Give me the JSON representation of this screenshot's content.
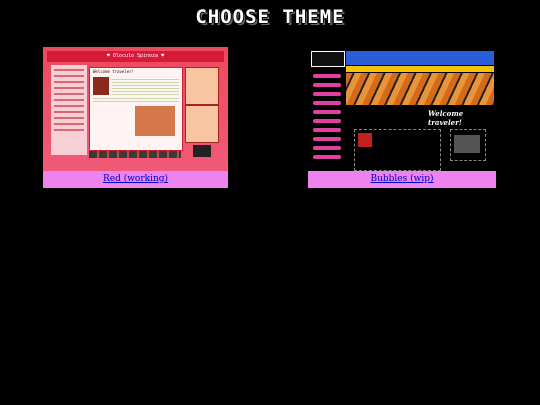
{
  "page": {
    "title": "CHOOSE THEME"
  },
  "themes": [
    {
      "caption": "Red (working)",
      "thumbnail": {
        "header": "♥ Oloculo Spinoza ♥",
        "heading": "Welcome traveler!"
      },
      "accent": "#ec4a5c"
    },
    {
      "caption": "Bubbles (wip)",
      "thumbnail": {
        "logo": "OOOUUOLO SPINOZA",
        "heading": "Welcome traveler!"
      },
      "accent": "#2a5ed8"
    }
  ],
  "colors": {
    "background": "#000000",
    "caption_bg": "#ee82ee",
    "link": "#0000cc"
  }
}
